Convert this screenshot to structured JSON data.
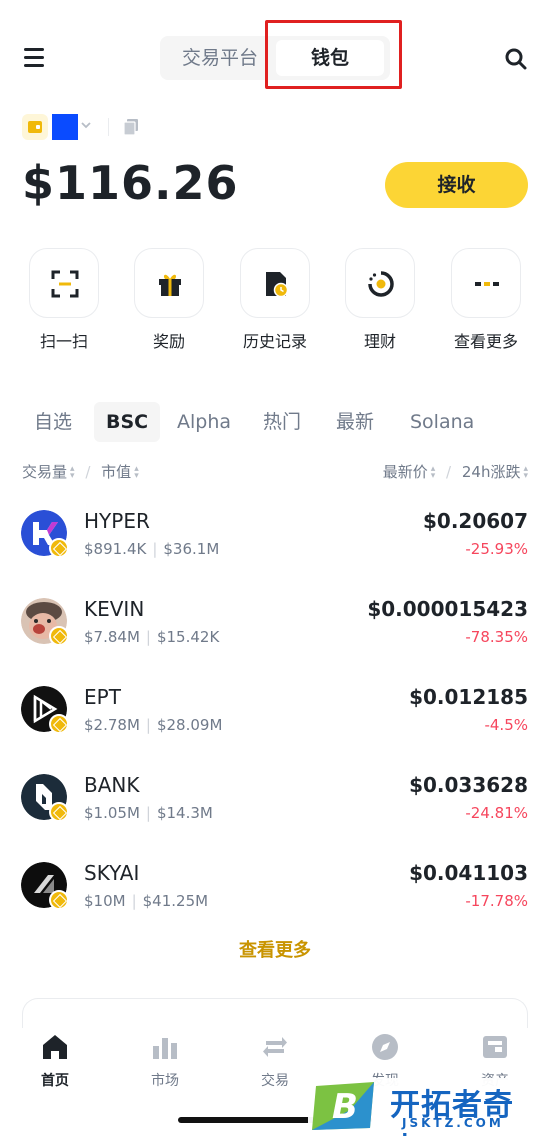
{
  "header": {
    "segments": [
      "交易平台",
      "钱包"
    ],
    "active_segment": "钱包"
  },
  "account": {
    "balance": "$116.26",
    "receive_label": "接收"
  },
  "actions": [
    {
      "label": "扫一扫",
      "icon": "scan-icon"
    },
    {
      "label": "奖励",
      "icon": "gift-icon"
    },
    {
      "label": "历史记录",
      "icon": "history-icon"
    },
    {
      "label": "理财",
      "icon": "earn-icon"
    },
    {
      "label": "查看更多",
      "icon": "more-icon"
    }
  ],
  "tabs": [
    "自选",
    "BSC",
    "Alpha",
    "热门",
    "最新",
    "Solana"
  ],
  "active_tab": "BSC",
  "sort": {
    "volume": "交易量",
    "market_cap": "市值",
    "last_price": "最新价",
    "change_24h": "24h涨跌"
  },
  "tokens": [
    {
      "name": "HYPER",
      "volume": "$891.4K",
      "market_cap": "$36.1M",
      "price": "$0.20607",
      "change": "-25.93%"
    },
    {
      "name": "KEVIN",
      "volume": "$7.84M",
      "market_cap": "$15.42K",
      "price": "$0.000015423",
      "change": "-78.35%"
    },
    {
      "name": "EPT",
      "volume": "$2.78M",
      "market_cap": "$28.09M",
      "price": "$0.012185",
      "change": "-4.5%"
    },
    {
      "name": "BANK",
      "volume": "$1.05M",
      "market_cap": "$14.3M",
      "price": "$0.033628",
      "change": "-24.81%"
    },
    {
      "name": "SKYAI",
      "volume": "$10M",
      "market_cap": "$41.25M",
      "price": "$0.041103",
      "change": "-17.78%"
    }
  ],
  "view_more": "查看更多",
  "bottom_nav": [
    {
      "label": "首页",
      "icon": "home-icon",
      "active": true
    },
    {
      "label": "市场",
      "icon": "market-icon",
      "active": false
    },
    {
      "label": "交易",
      "icon": "trade-icon",
      "active": false
    },
    {
      "label": "发现",
      "icon": "discover-icon",
      "active": false
    },
    {
      "label": "资产",
      "icon": "assets-icon",
      "active": false
    }
  ],
  "watermark": {
    "title": "开拓者奇点",
    "url": "JSKTZ.COM"
  },
  "colors": {
    "accent": "#fcd535",
    "negative": "#f6465d",
    "link": "#c99400",
    "highlight_box": "#e02020"
  }
}
